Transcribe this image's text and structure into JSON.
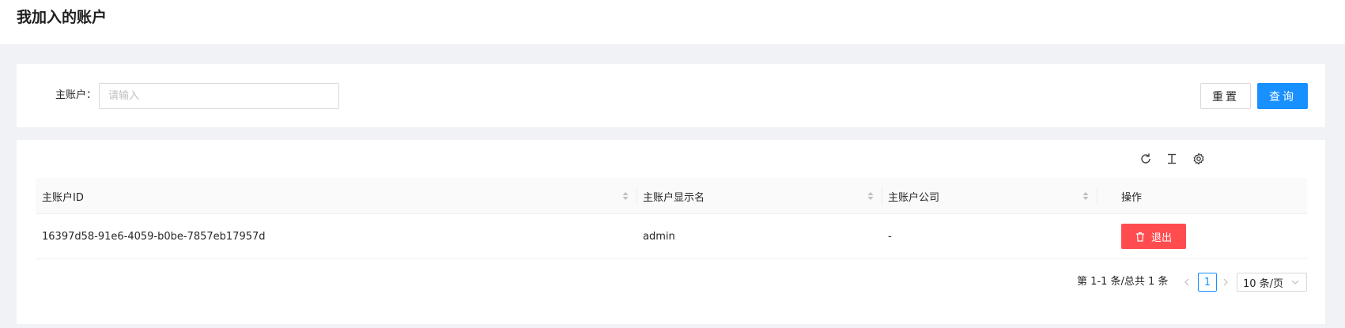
{
  "header": {
    "title": "我加入的账户"
  },
  "search": {
    "label": "主账户：",
    "placeholder": "请输入",
    "value": "",
    "reset_label": "重置",
    "query_label": "查询"
  },
  "toolbar": {
    "icons": [
      "reload-icon",
      "density-icon",
      "settings-icon"
    ]
  },
  "table": {
    "columns": [
      {
        "label": "主账户ID",
        "sortable": true
      },
      {
        "label": "主账户显示名",
        "sortable": true
      },
      {
        "label": "主账户公司",
        "sortable": true
      },
      {
        "label": "操作",
        "sortable": false
      }
    ],
    "rows": [
      {
        "id": "16397d58-91e6-4059-b0be-7857eb17957d",
        "display_name": "admin",
        "company": "-",
        "action_label": "退出"
      }
    ]
  },
  "pagination": {
    "total_text": "第 1-1 条/总共 1 条",
    "current_page": "1",
    "page_size": "10 条/页"
  },
  "colors": {
    "primary": "#1890ff",
    "danger": "#ff4d4f",
    "background": "#f0f2f5"
  }
}
